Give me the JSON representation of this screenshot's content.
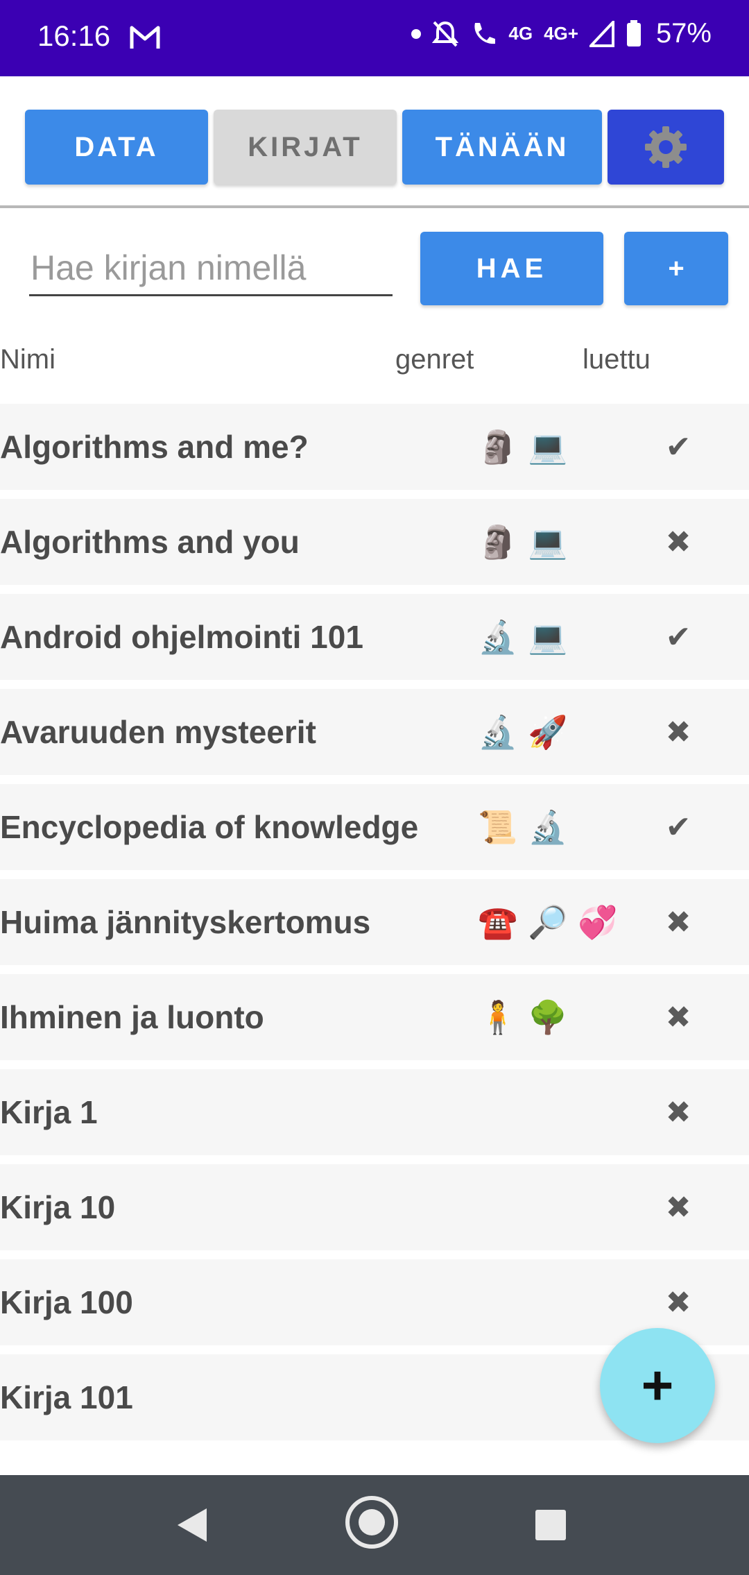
{
  "status_bar": {
    "time": "16:16",
    "network": "4G",
    "network2": "4G+",
    "battery": "57%"
  },
  "toolbar": {
    "data_label": "DATA",
    "kirjat_label": "KIRJAT",
    "tanaan_label": "TÄNÄÄN",
    "settings_icon": "gear-icon"
  },
  "search": {
    "placeholder": "Hae kirjan nimellä",
    "value": "",
    "search_label": "HAE",
    "add_label": "+"
  },
  "columns": {
    "name": "Nimi",
    "genres": "genret",
    "read": "luettu"
  },
  "books": [
    {
      "title": "Algorithms and me?",
      "genres": [
        "🗿",
        "💻"
      ],
      "read": "✔"
    },
    {
      "title": "Algorithms and you",
      "genres": [
        "🗿",
        "💻"
      ],
      "read": "✖"
    },
    {
      "title": "Android ohjelmointi 101",
      "genres": [
        "🔬",
        "💻"
      ],
      "read": "✔"
    },
    {
      "title": "Avaruuden mysteerit",
      "genres": [
        "🔬",
        "🚀"
      ],
      "read": "✖"
    },
    {
      "title": "Encyclopedia of knowledge",
      "genres": [
        "📜",
        "🔬"
      ],
      "read": "✔"
    },
    {
      "title": "Huima jännityskertomus",
      "genres": [
        "☎️",
        "🔎",
        "💞"
      ],
      "read": "✖"
    },
    {
      "title": "Ihminen ja luonto",
      "genres": [
        "🧍",
        "🌳"
      ],
      "read": "✖"
    },
    {
      "title": "Kirja 1",
      "genres": [],
      "read": "✖"
    },
    {
      "title": "Kirja 10",
      "genres": [],
      "read": "✖"
    },
    {
      "title": "Kirja 100",
      "genres": [],
      "read": "✖"
    },
    {
      "title": "Kirja 101",
      "genres": [],
      "read": ""
    }
  ],
  "fab": {
    "label": "+"
  },
  "colors": {
    "status_bar": "#3b00b3",
    "primary_button": "#3c8ae8",
    "settings_button": "#2f46d6",
    "inactive_tab": "#d9d9d9",
    "fab": "#8ee3f2",
    "nav_bar": "#454b52"
  }
}
